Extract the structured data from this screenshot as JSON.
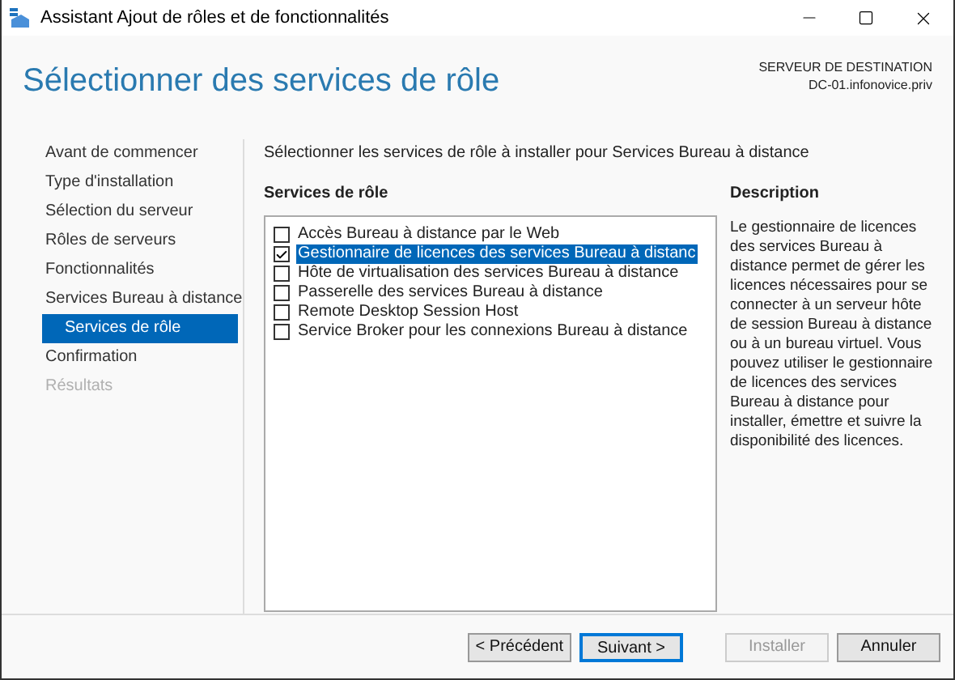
{
  "window": {
    "title": "Assistant Ajout de rôles et de fonctionnalités"
  },
  "header": {
    "title": "Sélectionner des services de rôle",
    "server_label": "SERVEUR DE DESTINATION",
    "server_name": "DC-01.infonovice.priv"
  },
  "nav": [
    {
      "label": "Avant de commencer",
      "selected": false,
      "disabled": false
    },
    {
      "label": "Type d'installation",
      "selected": false,
      "disabled": false
    },
    {
      "label": "Sélection du serveur",
      "selected": false,
      "disabled": false
    },
    {
      "label": "Rôles de serveurs",
      "selected": false,
      "disabled": false
    },
    {
      "label": "Fonctionnalités",
      "selected": false,
      "disabled": false
    },
    {
      "label": "Services Bureau à distance",
      "selected": false,
      "disabled": false,
      "children": [
        {
          "label": "Services de rôle",
          "selected": true,
          "disabled": false
        }
      ]
    },
    {
      "label": "Confirmation",
      "selected": false,
      "disabled": false
    },
    {
      "label": "Résultats",
      "selected": false,
      "disabled": true
    }
  ],
  "intro": "Sélectionner les services de rôle à installer pour Services Bureau à distance",
  "services": {
    "heading": "Services de rôle",
    "items": [
      {
        "label": "Accès Bureau à distance par le Web",
        "checked": false,
        "selected": false
      },
      {
        "label": "Gestionnaire de licences des services Bureau à distanc",
        "checked": true,
        "selected": true
      },
      {
        "label": "Hôte de virtualisation des services Bureau à distance",
        "checked": false,
        "selected": false
      },
      {
        "label": "Passerelle des services Bureau à distance",
        "checked": false,
        "selected": false
      },
      {
        "label": "Remote Desktop Session Host",
        "checked": false,
        "selected": false
      },
      {
        "label": "Service Broker pour les connexions Bureau à distance",
        "checked": false,
        "selected": false
      }
    ]
  },
  "description": {
    "heading": "Description",
    "text": "Le gestionnaire de licences des services Bureau à distance permet de gérer les licences nécessaires pour se connecter à un serveur hôte de session Bureau à distance ou à un bureau virtuel. Vous pouvez utiliser le gestionnaire de licences des services Bureau à distance pour installer, émettre et suivre la disponibilité des licences."
  },
  "buttons": [
    {
      "label": "< Précédent",
      "disabled": false,
      "focused": false
    },
    {
      "label": "Suivant >",
      "disabled": false,
      "focused": true
    },
    {
      "label": "Installer",
      "disabled": true,
      "focused": false
    },
    {
      "label": "Annuler",
      "disabled": false,
      "focused": false
    }
  ]
}
